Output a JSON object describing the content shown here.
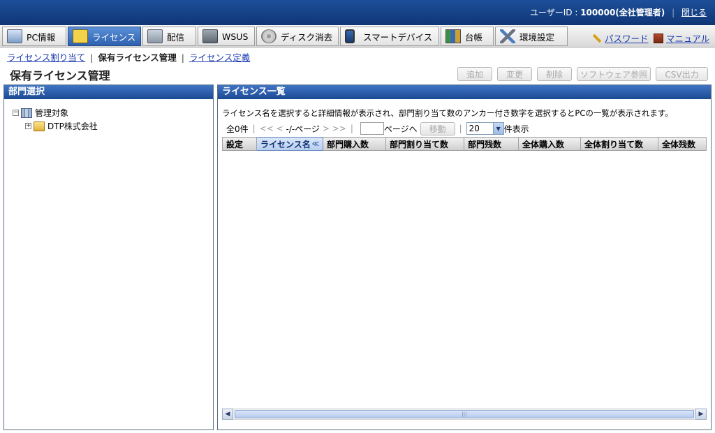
{
  "header": {
    "user_label": "ユーザーID :",
    "user_value": "100000(全社管理者)",
    "separator": "|",
    "close_label": "閉じる"
  },
  "menu": {
    "tabs": [
      {
        "label": "PC情報",
        "icon": "pc-icon"
      },
      {
        "label": "ライセンス",
        "icon": "license-icon",
        "active": true
      },
      {
        "label": "配信",
        "icon": "distribution-icon"
      },
      {
        "label": "WSUS",
        "icon": "wsus-icon"
      },
      {
        "label": "ディスク消去",
        "icon": "disk-erase-icon"
      },
      {
        "label": "スマートデバイス",
        "icon": "smart-device-icon"
      },
      {
        "label": "台帳",
        "icon": "ledger-icon"
      },
      {
        "label": "環境設定",
        "icon": "settings-tools-icon"
      }
    ],
    "password_label": "パスワード",
    "manual_label": "マニュアル"
  },
  "subnav": {
    "items": [
      "ライセンス割り当て",
      "保有ライセンス管理",
      "ライセンス定義"
    ],
    "current_index": 1,
    "separator": "|"
  },
  "page": {
    "title": "保有ライセンス管理",
    "buttons": [
      "追加",
      "変更",
      "削除",
      "ソフトウェア参照",
      "CSV出力"
    ]
  },
  "dept_panel": {
    "title": "部門選択",
    "tree": [
      {
        "label": "管理対象",
        "toggle": "−"
      },
      {
        "label": "DTP株式会社",
        "toggle": "+"
      }
    ]
  },
  "license_panel": {
    "title": "ライセンス一覧",
    "description": "ライセンス名を選択すると詳細情報が表示され、部門割り当て数のアンカー付き数字を選択するとPCの一覧が表示されます。",
    "pager": {
      "count": "全0件",
      "first": "<<",
      "prev": "<",
      "page_status": "-/-ページ",
      "next": ">",
      "last": ">>",
      "page_input": "",
      "goto_label": "ページへ",
      "move_button": "移動",
      "per_page_value": "20",
      "per_page_suffix": "件表示"
    },
    "columns": [
      "設定",
      "ライセンス名",
      "部門購入数",
      "部門割り当て数",
      "部門残数",
      "全体購入数",
      "全体割り当て数",
      "全体残数"
    ],
    "sorted_column": "ライセンス名",
    "sort_icon": "≪",
    "rows": [],
    "scroll_grip": "|||"
  },
  "colors": {
    "header_bg": "#1d4f9a",
    "panel_head": "#2e60b0",
    "active_tab": "#3d75c4",
    "link": "#1a3bb0"
  }
}
